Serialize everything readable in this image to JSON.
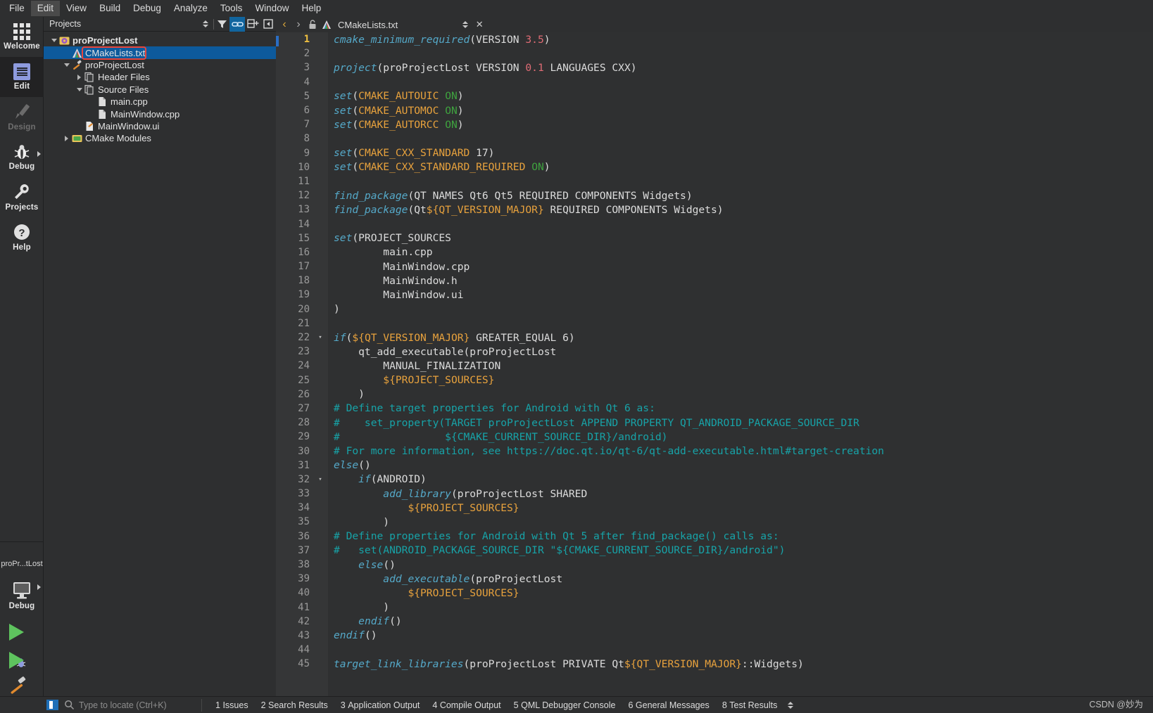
{
  "menu": {
    "items": [
      {
        "label": "File",
        "active": false
      },
      {
        "label": "Edit",
        "active": true
      },
      {
        "label": "View",
        "active": false
      },
      {
        "label": "Build",
        "active": false
      },
      {
        "label": "Debug",
        "active": false
      },
      {
        "label": "Analyze",
        "active": false
      },
      {
        "label": "Tools",
        "active": false
      },
      {
        "label": "Window",
        "active": false
      },
      {
        "label": "Help",
        "active": false
      }
    ]
  },
  "modebar": {
    "items": [
      {
        "label": "Welcome",
        "icon": "grid-icon",
        "selected": false,
        "dim": false
      },
      {
        "label": "Edit",
        "icon": "document-lines-icon",
        "selected": true,
        "dim": false
      },
      {
        "label": "Design",
        "icon": "pencil-icon",
        "selected": false,
        "dim": true
      },
      {
        "label": "Debug",
        "icon": "bug-icon",
        "selected": false,
        "dim": false,
        "arrow": true
      },
      {
        "label": "Projects",
        "icon": "wrench-icon",
        "selected": false,
        "dim": false
      },
      {
        "label": "Help",
        "icon": "question-circle-icon",
        "selected": false,
        "dim": false
      }
    ],
    "kit_label": "proPr...tLost",
    "kit_mode": "Debug",
    "run_button": "run-icon",
    "debug_button": "run-debug-icon",
    "build_button": "hammer-icon"
  },
  "projects_pane": {
    "title": "Projects",
    "toolbar": [
      {
        "name": "sync-updown-icon",
        "active": false
      },
      {
        "name": "filter-icon",
        "active": false
      },
      {
        "name": "link-icon",
        "active": true
      },
      {
        "name": "split-add-icon",
        "active": false
      },
      {
        "name": "close-split-icon",
        "active": false
      }
    ],
    "tree": [
      {
        "label": "proProjectLost",
        "indent": 0,
        "twist": "down",
        "icon": "project-gear-icon",
        "bold": true,
        "selected": false,
        "highlight": false
      },
      {
        "label": "CMakeLists.txt",
        "indent": 1,
        "twist": "none",
        "icon": "cmake-icon",
        "bold": false,
        "selected": true,
        "highlight": true
      },
      {
        "label": "proProjectLost",
        "indent": 1,
        "twist": "down",
        "icon": "target-icon",
        "bold": false,
        "selected": false,
        "highlight": false
      },
      {
        "label": "Header Files",
        "indent": 2,
        "twist": "right",
        "icon": "folder-files-icon",
        "bold": false,
        "selected": false,
        "highlight": false
      },
      {
        "label": "Source Files",
        "indent": 2,
        "twist": "down",
        "icon": "folder-files-icon",
        "bold": false,
        "selected": false,
        "highlight": false
      },
      {
        "label": "main.cpp",
        "indent": 3,
        "twist": "none",
        "icon": "file-icon",
        "bold": false,
        "selected": false,
        "highlight": false
      },
      {
        "label": "MainWindow.cpp",
        "indent": 3,
        "twist": "none",
        "icon": "file-icon",
        "bold": false,
        "selected": false,
        "highlight": false
      },
      {
        "label": "MainWindow.ui",
        "indent": 2,
        "twist": "none",
        "icon": "ui-file-icon",
        "bold": false,
        "selected": false,
        "highlight": false
      },
      {
        "label": "CMake Modules",
        "indent": 1,
        "twist": "right",
        "icon": "modules-icon",
        "bold": false,
        "selected": false,
        "highlight": false
      }
    ]
  },
  "editor": {
    "tab_filename": "CMakeLists.txt",
    "nav_back": "‹",
    "nav_forward": "›",
    "lock_icon": "unlocked-icon",
    "file_icon": "cmake-icon",
    "split_icon": "updown-arrows-icon",
    "close_icon": "✕",
    "current_line": 1,
    "lines": [
      {
        "n": 1,
        "fold": "",
        "tokens": [
          {
            "t": "cmake_minimum_required",
            "c": "fn"
          },
          {
            "t": "(",
            "c": "plain"
          },
          {
            "t": "VERSION ",
            "c": "plain"
          },
          {
            "t": "3.5",
            "c": "num"
          },
          {
            "t": ")",
            "c": "plain"
          }
        ]
      },
      {
        "n": 2,
        "fold": "",
        "tokens": []
      },
      {
        "n": 3,
        "fold": "",
        "tokens": [
          {
            "t": "project",
            "c": "fn"
          },
          {
            "t": "(proProjectLost VERSION ",
            "c": "plain"
          },
          {
            "t": "0.1",
            "c": "num"
          },
          {
            "t": " LANGUAGES CXX)",
            "c": "plain"
          }
        ]
      },
      {
        "n": 4,
        "fold": "",
        "tokens": []
      },
      {
        "n": 5,
        "fold": "",
        "tokens": [
          {
            "t": "set",
            "c": "fn"
          },
          {
            "t": "(",
            "c": "plain"
          },
          {
            "t": "CMAKE_AUTOUIC",
            "c": "var"
          },
          {
            "t": " ",
            "c": "plain"
          },
          {
            "t": "ON",
            "c": "on"
          },
          {
            "t": ")",
            "c": "plain"
          }
        ]
      },
      {
        "n": 6,
        "fold": "",
        "tokens": [
          {
            "t": "set",
            "c": "fn"
          },
          {
            "t": "(",
            "c": "plain"
          },
          {
            "t": "CMAKE_AUTOMOC",
            "c": "var"
          },
          {
            "t": " ",
            "c": "plain"
          },
          {
            "t": "ON",
            "c": "on"
          },
          {
            "t": ")",
            "c": "plain"
          }
        ]
      },
      {
        "n": 7,
        "fold": "",
        "tokens": [
          {
            "t": "set",
            "c": "fn"
          },
          {
            "t": "(",
            "c": "plain"
          },
          {
            "t": "CMAKE_AUTORCC",
            "c": "var"
          },
          {
            "t": " ",
            "c": "plain"
          },
          {
            "t": "ON",
            "c": "on"
          },
          {
            "t": ")",
            "c": "plain"
          }
        ]
      },
      {
        "n": 8,
        "fold": "",
        "tokens": []
      },
      {
        "n": 9,
        "fold": "",
        "tokens": [
          {
            "t": "set",
            "c": "fn"
          },
          {
            "t": "(",
            "c": "plain"
          },
          {
            "t": "CMAKE_CXX_STANDARD",
            "c": "var"
          },
          {
            "t": " 17)",
            "c": "plain"
          }
        ]
      },
      {
        "n": 10,
        "fold": "",
        "tokens": [
          {
            "t": "set",
            "c": "fn"
          },
          {
            "t": "(",
            "c": "plain"
          },
          {
            "t": "CMAKE_CXX_STANDARD_REQUIRED",
            "c": "var"
          },
          {
            "t": " ",
            "c": "plain"
          },
          {
            "t": "ON",
            "c": "on"
          },
          {
            "t": ")",
            "c": "plain"
          }
        ]
      },
      {
        "n": 11,
        "fold": "",
        "tokens": []
      },
      {
        "n": 12,
        "fold": "",
        "tokens": [
          {
            "t": "find_package",
            "c": "fn"
          },
          {
            "t": "(QT NAMES Qt6 Qt5 REQUIRED COMPONENTS Widgets)",
            "c": "plain"
          }
        ]
      },
      {
        "n": 13,
        "fold": "",
        "tokens": [
          {
            "t": "find_package",
            "c": "fn"
          },
          {
            "t": "(Qt",
            "c": "plain"
          },
          {
            "t": "${QT_VERSION_MAJOR}",
            "c": "var"
          },
          {
            "t": " REQUIRED COMPONENTS Widgets)",
            "c": "plain"
          }
        ]
      },
      {
        "n": 14,
        "fold": "",
        "tokens": []
      },
      {
        "n": 15,
        "fold": "",
        "tokens": [
          {
            "t": "set",
            "c": "fn"
          },
          {
            "t": "(PROJECT_SOURCES",
            "c": "plain"
          }
        ]
      },
      {
        "n": 16,
        "fold": "",
        "tokens": [
          {
            "t": "        main.cpp",
            "c": "plain"
          }
        ]
      },
      {
        "n": 17,
        "fold": "",
        "tokens": [
          {
            "t": "        MainWindow.cpp",
            "c": "plain"
          }
        ]
      },
      {
        "n": 18,
        "fold": "",
        "tokens": [
          {
            "t": "        MainWindow.h",
            "c": "plain"
          }
        ]
      },
      {
        "n": 19,
        "fold": "",
        "tokens": [
          {
            "t": "        MainWindow.ui",
            "c": "plain"
          }
        ]
      },
      {
        "n": 20,
        "fold": "",
        "tokens": [
          {
            "t": ")",
            "c": "plain"
          }
        ]
      },
      {
        "n": 21,
        "fold": "",
        "tokens": []
      },
      {
        "n": 22,
        "fold": "▾",
        "tokens": [
          {
            "t": "if",
            "c": "kw"
          },
          {
            "t": "(",
            "c": "plain"
          },
          {
            "t": "${QT_VERSION_MAJOR}",
            "c": "var"
          },
          {
            "t": " GREATER_EQUAL 6)",
            "c": "plain"
          }
        ]
      },
      {
        "n": 23,
        "fold": "",
        "tokens": [
          {
            "t": "    qt_add_executable(proProjectLost",
            "c": "plain"
          }
        ]
      },
      {
        "n": 24,
        "fold": "",
        "tokens": [
          {
            "t": "        MANUAL_FINALIZATION",
            "c": "plain"
          }
        ]
      },
      {
        "n": 25,
        "fold": "",
        "tokens": [
          {
            "t": "        ",
            "c": "plain"
          },
          {
            "t": "${PROJECT_SOURCES}",
            "c": "var"
          }
        ]
      },
      {
        "n": 26,
        "fold": "",
        "tokens": [
          {
            "t": "    )",
            "c": "plain"
          }
        ]
      },
      {
        "n": 27,
        "fold": "",
        "tokens": [
          {
            "t": "# Define target properties for Android with Qt 6 as:",
            "c": "cmt"
          }
        ]
      },
      {
        "n": 28,
        "fold": "",
        "tokens": [
          {
            "t": "#    set_property(TARGET proProjectLost APPEND PROPERTY QT_ANDROID_PACKAGE_SOURCE_DIR",
            "c": "cmt"
          }
        ]
      },
      {
        "n": 29,
        "fold": "",
        "tokens": [
          {
            "t": "#                 ${CMAKE_CURRENT_SOURCE_DIR}/android)",
            "c": "cmt"
          }
        ]
      },
      {
        "n": 30,
        "fold": "",
        "tokens": [
          {
            "t": "# For more information, see https://doc.qt.io/qt-6/qt-add-executable.html#target-creation",
            "c": "cmt"
          }
        ]
      },
      {
        "n": 31,
        "fold": "",
        "tokens": [
          {
            "t": "else",
            "c": "kw"
          },
          {
            "t": "()",
            "c": "plain"
          }
        ]
      },
      {
        "n": 32,
        "fold": "▾",
        "tokens": [
          {
            "t": "    ",
            "c": "plain"
          },
          {
            "t": "if",
            "c": "kw"
          },
          {
            "t": "(ANDROID)",
            "c": "plain"
          }
        ]
      },
      {
        "n": 33,
        "fold": "",
        "tokens": [
          {
            "t": "        ",
            "c": "plain"
          },
          {
            "t": "add_library",
            "c": "fn"
          },
          {
            "t": "(proProjectLost SHARED",
            "c": "plain"
          }
        ]
      },
      {
        "n": 34,
        "fold": "",
        "tokens": [
          {
            "t": "            ",
            "c": "plain"
          },
          {
            "t": "${PROJECT_SOURCES}",
            "c": "var"
          }
        ]
      },
      {
        "n": 35,
        "fold": "",
        "tokens": [
          {
            "t": "        )",
            "c": "plain"
          }
        ]
      },
      {
        "n": 36,
        "fold": "",
        "tokens": [
          {
            "t": "# Define properties for Android with Qt 5 after find_package() calls as:",
            "c": "cmt"
          }
        ]
      },
      {
        "n": 37,
        "fold": "",
        "tokens": [
          {
            "t": "#   set(ANDROID_PACKAGE_SOURCE_DIR \"${CMAKE_CURRENT_SOURCE_DIR}/android\")",
            "c": "cmt"
          }
        ]
      },
      {
        "n": 38,
        "fold": "",
        "tokens": [
          {
            "t": "    ",
            "c": "plain"
          },
          {
            "t": "else",
            "c": "kw"
          },
          {
            "t": "()",
            "c": "plain"
          }
        ]
      },
      {
        "n": 39,
        "fold": "",
        "tokens": [
          {
            "t": "        ",
            "c": "plain"
          },
          {
            "t": "add_executable",
            "c": "fn"
          },
          {
            "t": "(proProjectLost",
            "c": "plain"
          }
        ]
      },
      {
        "n": 40,
        "fold": "",
        "tokens": [
          {
            "t": "            ",
            "c": "plain"
          },
          {
            "t": "${PROJECT_SOURCES}",
            "c": "var"
          }
        ]
      },
      {
        "n": 41,
        "fold": "",
        "tokens": [
          {
            "t": "        )",
            "c": "plain"
          }
        ]
      },
      {
        "n": 42,
        "fold": "",
        "tokens": [
          {
            "t": "    ",
            "c": "plain"
          },
          {
            "t": "endif",
            "c": "kw"
          },
          {
            "t": "()",
            "c": "plain"
          }
        ]
      },
      {
        "n": 43,
        "fold": "",
        "tokens": [
          {
            "t": "endif",
            "c": "kw"
          },
          {
            "t": "()",
            "c": "plain"
          }
        ]
      },
      {
        "n": 44,
        "fold": "",
        "tokens": []
      },
      {
        "n": 45,
        "fold": "",
        "tokens": [
          {
            "t": "target_link_libraries",
            "c": "fn"
          },
          {
            "t": "(proProjectLost PRIVATE Qt",
            "c": "plain"
          },
          {
            "t": "${QT_VERSION_MAJOR}",
            "c": "var"
          },
          {
            "t": "::Widgets)",
            "c": "plain"
          }
        ]
      }
    ]
  },
  "statusbar": {
    "locate_placeholder": "Type to locate (Ctrl+K)",
    "items": [
      {
        "num": "1",
        "label": "Issues"
      },
      {
        "num": "2",
        "label": "Search Results"
      },
      {
        "num": "3",
        "label": "Application Output"
      },
      {
        "num": "4",
        "label": "Compile Output"
      },
      {
        "num": "5",
        "label": "QML Debugger Console"
      },
      {
        "num": "6",
        "label": "General Messages"
      },
      {
        "num": "8",
        "label": "Test Results"
      }
    ]
  },
  "watermark": "CSDN @妙为",
  "colors": {
    "accent_blue": "#0d5a9c",
    "toolbar_active": "#11659e",
    "highlight_red": "#e8453c",
    "comment": "#17a3a8",
    "function": "#55a9c9",
    "variable": "#e8a23d",
    "number": "#e06c75",
    "boolean_on": "#3fa33f",
    "bg_editor": "#2f3031",
    "bg_chrome": "#2e2f30",
    "bg_gutter": "#353637"
  }
}
